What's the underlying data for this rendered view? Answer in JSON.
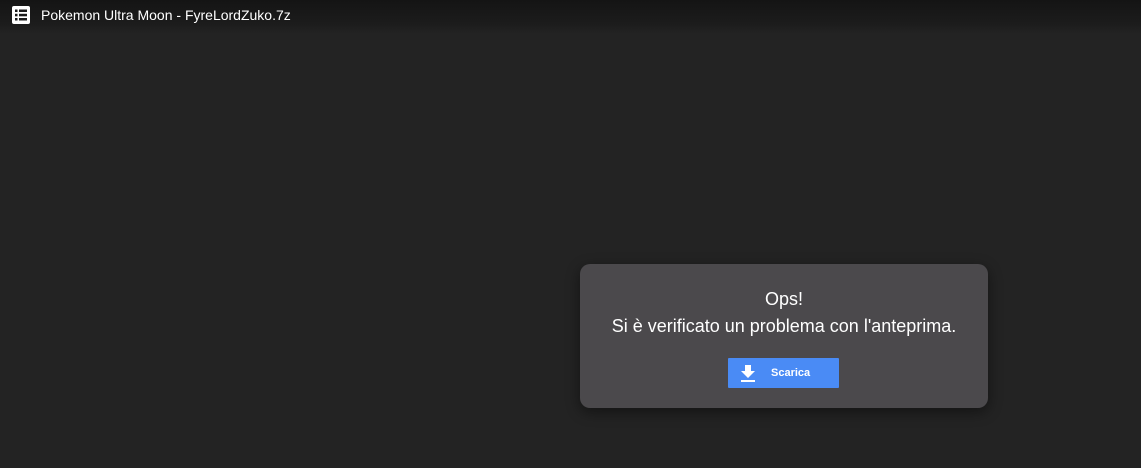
{
  "header": {
    "file_icon": "file-list-icon",
    "title": "Pokemon Ultra Moon - FyreLordZuko.7z"
  },
  "preview_error": {
    "heading": "Ops!",
    "message": "Si è verificato un problema con l'anteprima.",
    "download_button": {
      "icon": "download-icon",
      "label": "Scarica"
    }
  },
  "colors": {
    "background": "#232323",
    "card": "#4b494c",
    "accent": "#4a8bf5",
    "text": "#ffffff"
  }
}
